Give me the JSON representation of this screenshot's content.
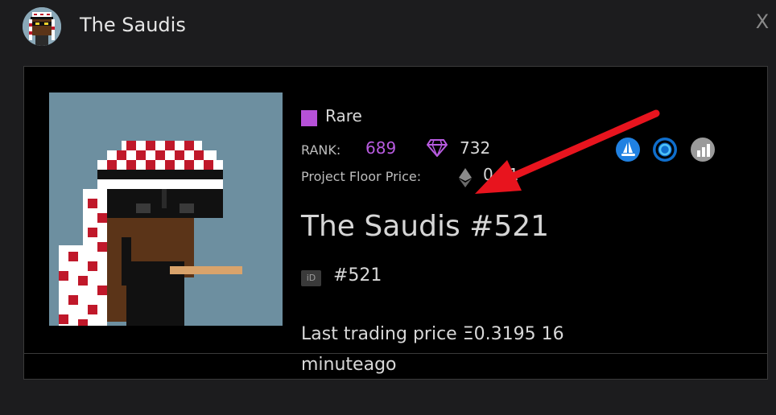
{
  "header": {
    "title": "The Saudis",
    "close_icon": "X"
  },
  "card": {
    "rarity_label": "Rare",
    "rarity_color": "#b651d8",
    "rank_label": "RANK:",
    "rank_value": "689",
    "diamond_value": "732",
    "floor_label": "Project Floor Price:",
    "floor_value": "0.31",
    "nft_title": "The Saudis #521",
    "id_badge": "iD",
    "id_value": "#521",
    "trade_line1": "Last trading price Ξ0.3195 16",
    "trade_line2": "minuteago",
    "market_icons": [
      "opensea-icon",
      "looksrare-icon",
      "chart-icon"
    ]
  }
}
